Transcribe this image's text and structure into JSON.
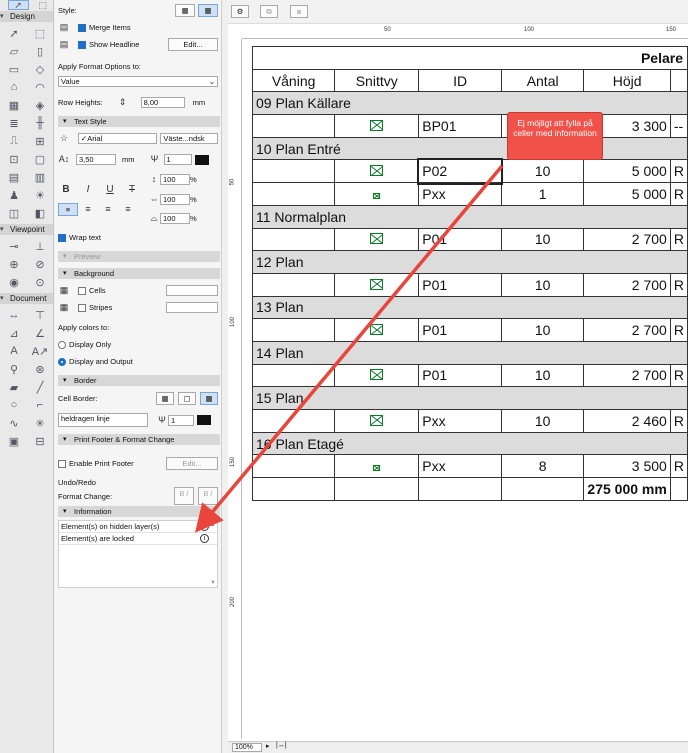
{
  "toolbox": {
    "design_label": "Design",
    "viewpoint_label": "Viewpoint",
    "document_label": "Document",
    "design_icons": [
      "arrow-icon",
      "marquee-icon",
      "wall-icon",
      "column-icon",
      "beam-icon",
      "slab-icon",
      "roof-icon",
      "shell-icon",
      "mesh-icon",
      "morph-icon",
      "stair-icon",
      "railing-icon",
      "door-icon",
      "window-icon",
      "skylight-icon",
      "opening-icon",
      "curtainwall-icon",
      "zone-icon",
      "object-icon",
      "lamp-icon",
      "panel-icon",
      "frame-icon"
    ],
    "viewpoint_icons": [
      "section-icon",
      "elevation-icon",
      "detail-icon",
      "worksheet-icon",
      "camera-icon",
      "interior-icon"
    ],
    "document_icons": [
      "dimension-icon",
      "level-icon",
      "radial-icon",
      "angle-icon",
      "text-icon",
      "label-icon",
      "marker-icon",
      "spot-icon",
      "fill-icon",
      "line-icon",
      "circle-icon",
      "polyline-icon",
      "spline-icon",
      "hotspot-icon",
      "figure-icon",
      "drawing-icon"
    ]
  },
  "panel": {
    "style_label": "Style:",
    "merge_items": "Merge Items",
    "show_headline": "Show Headline",
    "edit_btn": "Edit...",
    "apply_format_label": "Apply Format Options to:",
    "apply_format_value": "Value",
    "row_heights_label": "Row Heights:",
    "row_heights_value": "8,00",
    "mm": "mm",
    "text_style_section": "Text Style",
    "font": "Arial",
    "font_encoding": "Väste...ndsk",
    "font_size": "3,50",
    "pen_value": "1",
    "pct1": "100",
    "pct2": "100",
    "pct3": "100",
    "pct4": "100",
    "pct": "%",
    "bold": "B",
    "italic": "I",
    "underline": "U",
    "strike": "T",
    "wrap_text": "Wrap text",
    "preview_section": "Preview",
    "background_section": "Background",
    "cells": "Cells",
    "stripes": "Stripes",
    "apply_colors_label": "Apply colors to:",
    "display_only": "Display Only",
    "display_output": "Display and Output",
    "border_section": "Border",
    "cell_border_label": "Cell Border:",
    "line_type": "heldragen linje",
    "border_pen": "1",
    "print_footer_section": "Print Footer & Format Change",
    "enable_print_footer": "Enable Print Footer",
    "edit_btn2": "Edit...",
    "undo_redo": "Undo/Redo",
    "format_change": "Format Change:",
    "undo_label": "B /",
    "redo_label": "B /",
    "information_section": "Information",
    "info_items": [
      "Element(s) on hidden layer(s)",
      "Element(s) are locked"
    ]
  },
  "rulers": {
    "h_marks": [
      "50",
      "100",
      "150"
    ],
    "v_marks": [
      "50",
      "100",
      "150",
      "200"
    ]
  },
  "status": {
    "zoom": "100%"
  },
  "schedule": {
    "title": "Pelare",
    "headers": [
      "Våning",
      "Snittvy",
      "ID",
      "Antal",
      "Höjd"
    ],
    "groups": [
      {
        "name": "09 Plan Källare",
        "rows": [
          {
            "sym": "plan",
            "id": "BP01",
            "antal": "",
            "hojd": "3 300",
            "extra": "--"
          }
        ]
      },
      {
        "name": "10 Plan Entré",
        "rows": [
          {
            "sym": "big",
            "id": "P02",
            "antal": "10",
            "hojd": "5 000",
            "extra": "R"
          },
          {
            "sym": "small",
            "id": "Pxx",
            "antal": "1",
            "hojd": "5 000",
            "extra": "R"
          }
        ]
      },
      {
        "name": "11 Normalplan",
        "rows": [
          {
            "sym": "big",
            "id": "P01",
            "antal": "10",
            "hojd": "2 700",
            "extra": "R"
          }
        ]
      },
      {
        "name": "12 Plan",
        "rows": [
          {
            "sym": "big",
            "id": "P01",
            "antal": "10",
            "hojd": "2 700",
            "extra": "R"
          }
        ]
      },
      {
        "name": "13 Plan",
        "rows": [
          {
            "sym": "big",
            "id": "P01",
            "antal": "10",
            "hojd": "2 700",
            "extra": "R"
          }
        ]
      },
      {
        "name": "14 Plan",
        "rows": [
          {
            "sym": "big",
            "id": "P01",
            "antal": "10",
            "hojd": "2 700",
            "extra": "R"
          }
        ]
      },
      {
        "name": "15 Plan",
        "rows": [
          {
            "sym": "big",
            "id": "Pxx",
            "antal": "10",
            "hojd": "2 460",
            "extra": "R"
          }
        ]
      },
      {
        "name": "16 Plan Etagé",
        "rows": [
          {
            "sym": "small",
            "id": "Pxx",
            "antal": "8",
            "hojd": "3 500",
            "extra": "R"
          }
        ]
      }
    ],
    "total": "275 000 mm"
  },
  "callout": {
    "text": "Ej möjligt att fylla på celler med information",
    "color": "#f0524a"
  },
  "colors": {
    "accent": "#1f6fc6",
    "arrow": "#e8453c",
    "symbol": "#0a7a2a",
    "group_row": "#dcdcdc"
  }
}
